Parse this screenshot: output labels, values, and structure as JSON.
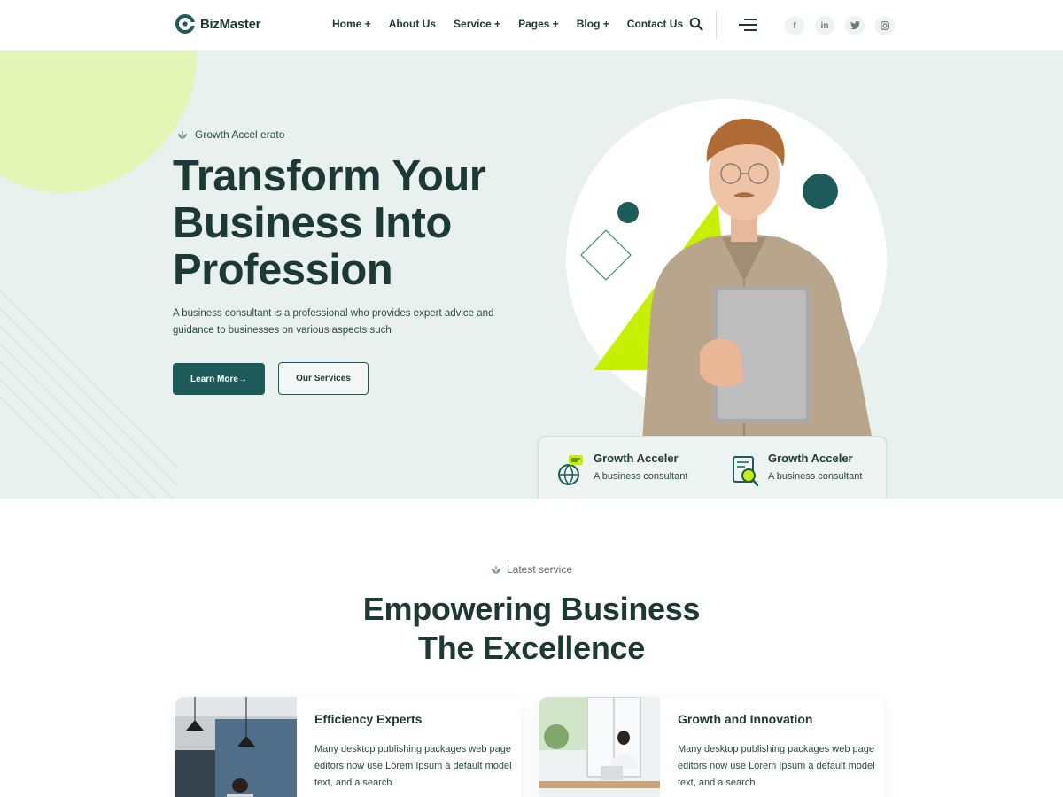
{
  "header": {
    "logo_text": "BizMaster",
    "nav": [
      "Home +",
      "About Us",
      "Service +",
      "Pages +",
      "Blog +",
      "Contact Us"
    ],
    "icons": [
      "search-icon",
      "menu-icon"
    ],
    "socials": [
      {
        "name": "facebook-icon",
        "glyph": "f"
      },
      {
        "name": "linkedin-icon",
        "glyph": "in"
      },
      {
        "name": "twitter-icon",
        "glyph": "t"
      },
      {
        "name": "instagram-icon",
        "glyph": "◎"
      }
    ]
  },
  "hero": {
    "eyebrow": "Growth Accel erato",
    "title": "Transform Your Business Into Profession",
    "description": "A business consultant is a professional who provides expert advice and guidance to businesses on various aspects such",
    "primary_button": "Learn More→",
    "secondary_button": "Our Services",
    "stats": [
      {
        "title": "Growth Acceler",
        "desc": "A business consultant",
        "icon": "globe-chat-icon"
      },
      {
        "title": "Growth Acceler",
        "desc": "A business consultant",
        "icon": "report-search-icon"
      }
    ]
  },
  "services": {
    "eyebrow": "Latest service",
    "title_line1": "Empowering Business",
    "title_line2": "The Excellence",
    "cards": [
      {
        "title": "Efficiency Experts",
        "text": "Many desktop publishing packages web page editors now use Lorem Ipsum a default model text, and a search"
      },
      {
        "title": "Growth and Innovation",
        "text": "Many desktop publishing packages web page editors now use Lorem Ipsum a default model text, and a search"
      }
    ]
  },
  "colors": {
    "primary": "#1d5a5a",
    "heading": "#1c3a33",
    "accent_lime": "#c6f000",
    "hero_bg": "#e9f1ee"
  }
}
